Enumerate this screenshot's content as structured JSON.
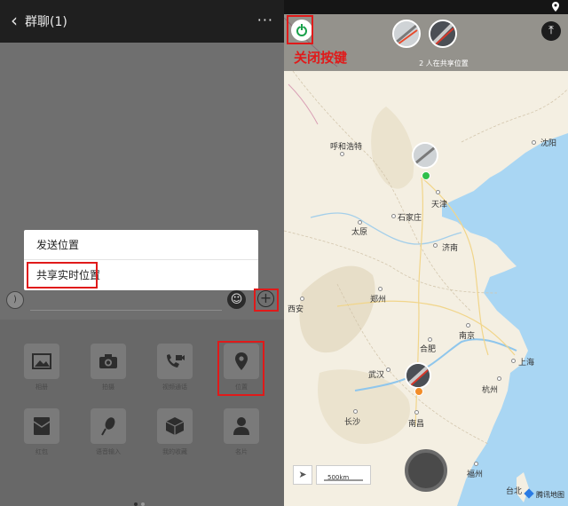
{
  "chat": {
    "back_icon": "back-arrow-icon",
    "title": "群聊(1)",
    "more_icon": "more-dots-icon",
    "menu": {
      "send_location": "发送位置",
      "share_realtime": "共享实时位置"
    },
    "tools": [
      "相册",
      "拍摄",
      "视频通话",
      "位置",
      "红包",
      "语音输入",
      "我的收藏",
      "名片"
    ],
    "page_dots": 2
  },
  "map": {
    "close_label": "关闭按键",
    "share_count": "2 人在共享位置",
    "scale": "500km",
    "brand": "腾讯地图",
    "cities": {
      "hohhot": "呼和浩特",
      "shenyang": "沈阳",
      "tianjin": "天津",
      "shijiazhuang": "石家庄",
      "taiyuan": "太原",
      "jinan": "济南",
      "zhengzhou": "郑州",
      "xian": "西安",
      "nanjing": "南京",
      "hefei": "合肥",
      "shanghai": "上海",
      "wuhan": "武汉",
      "hangzhou": "杭州",
      "changsha": "长沙",
      "nanchang": "南昌",
      "fuzhou": "福州",
      "taibei": "台北"
    },
    "colors": {
      "highlight_red": "#e01a1a",
      "power_green": "#1aa14b",
      "sea": "#a9d6f3",
      "land": "#f4efe2"
    }
  }
}
